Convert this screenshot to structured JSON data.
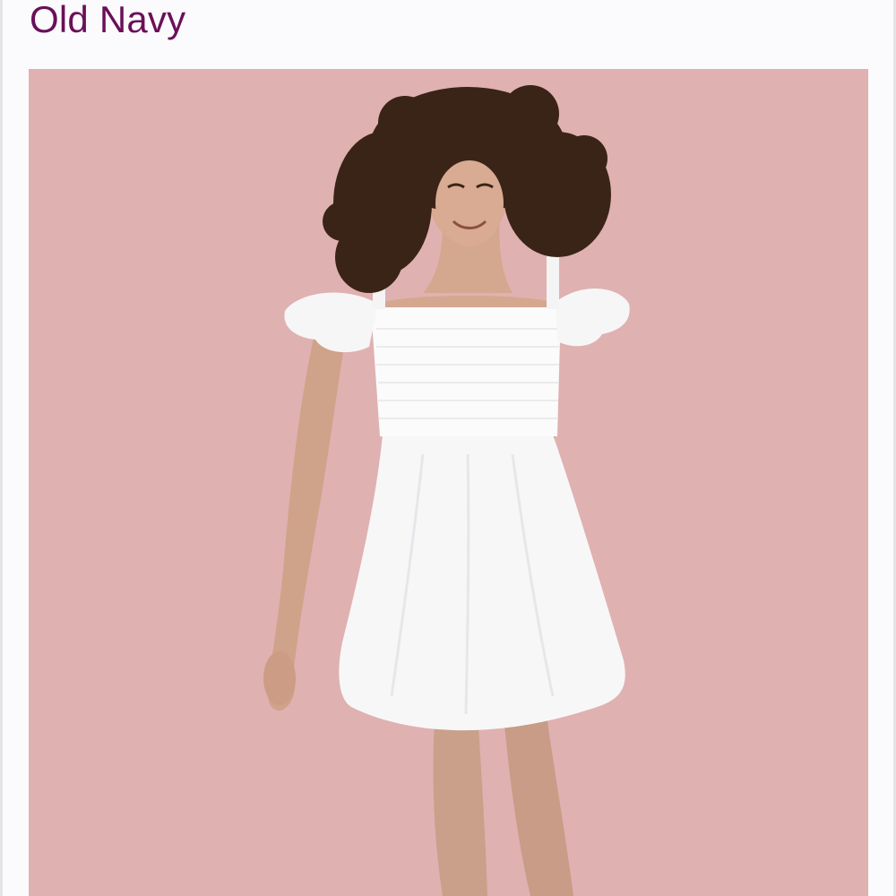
{
  "listing": {
    "brand": "Old Navy"
  },
  "colors": {
    "brand_text": "#6b0f58",
    "image_background": "#e0b1b1",
    "page_background": "#fbfafc"
  },
  "image": {
    "subject": "model-in-white-dress"
  }
}
